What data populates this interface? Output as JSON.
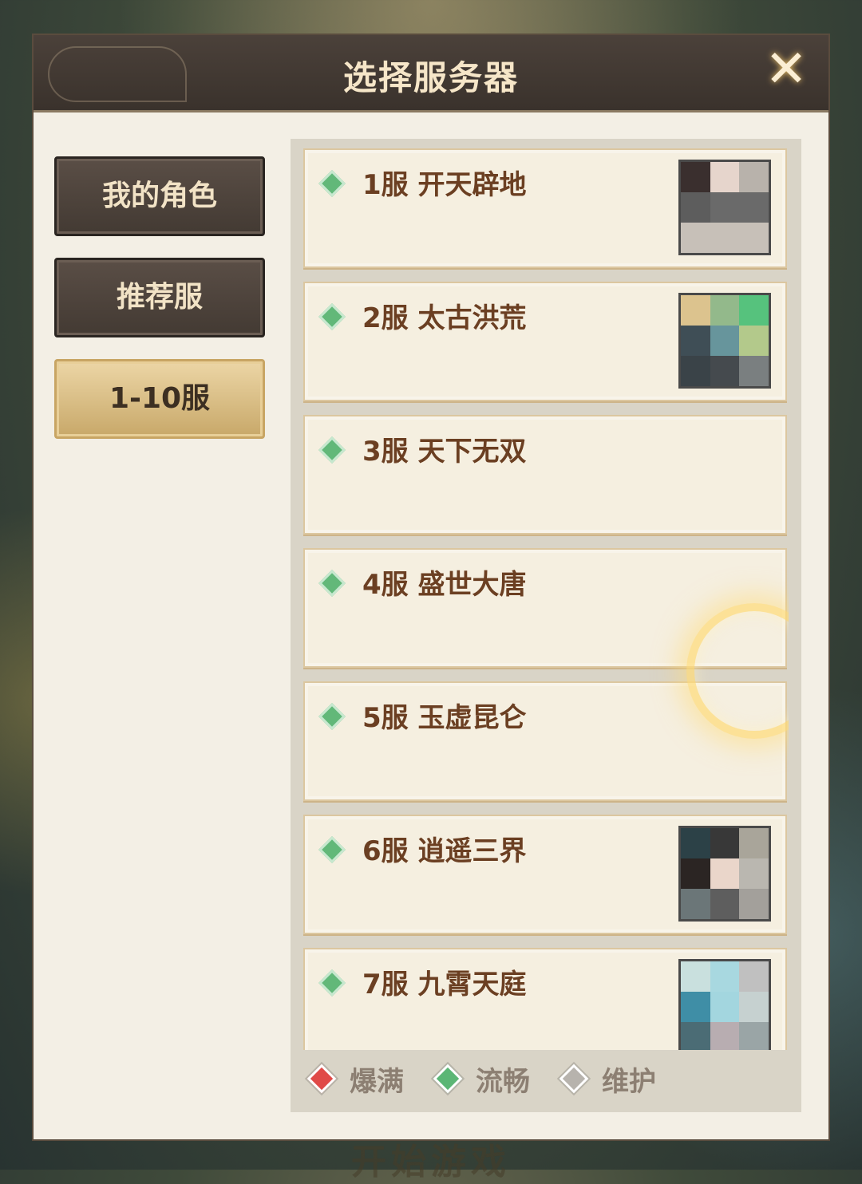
{
  "dialog": {
    "title": "选择服务器",
    "close_icon": "✕"
  },
  "sidebar": {
    "items": [
      {
        "label": "我的角色",
        "selected": false
      },
      {
        "label": "推荐服",
        "selected": false
      },
      {
        "label": "1-10服",
        "selected": true
      }
    ]
  },
  "servers": [
    {
      "name": "1服 开天辟地",
      "status": "流畅",
      "has_avatar": true
    },
    {
      "name": "2服 太古洪荒",
      "status": "流畅",
      "has_avatar": true
    },
    {
      "name": "3服 天下无双",
      "status": "流畅",
      "has_avatar": false
    },
    {
      "name": "4服 盛世大唐",
      "status": "流畅",
      "has_avatar": false
    },
    {
      "name": "5服 玉虚昆仑",
      "status": "流畅",
      "has_avatar": false
    },
    {
      "name": "6服 逍遥三界",
      "status": "流畅",
      "has_avatar": true
    },
    {
      "name": "7服 九霄天庭",
      "status": "流畅",
      "has_avatar": true
    }
  ],
  "legend": [
    {
      "label": "爆满",
      "color": "#e04a48"
    },
    {
      "label": "流畅",
      "color": "#5bb675"
    },
    {
      "label": "维护",
      "color": "#b7b3ad"
    }
  ],
  "background_button_text": "开始游戏",
  "colors": {
    "status_smooth": "#62b879",
    "accent_gold": "#c8a869",
    "panel_header": "#3a322c"
  }
}
